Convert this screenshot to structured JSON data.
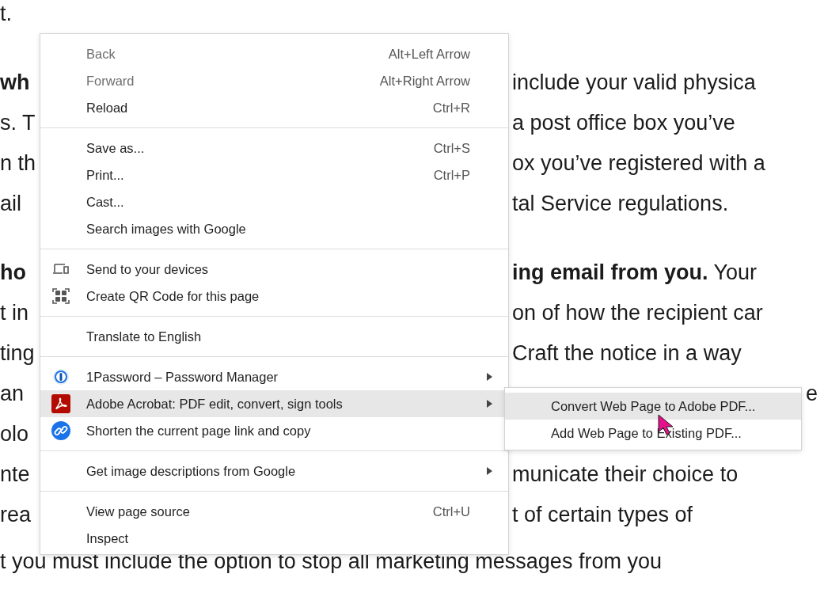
{
  "page_text": {
    "paragraphs": [
      [
        {
          "left": "t."
        }
      ],
      [
        {
          "left": "**wh**",
          "right": "include your valid physica"
        },
        {
          "left": "s. T",
          "right": "a post office box you’ve"
        },
        {
          "left": "n th",
          "right": "ox you’ve registered with a"
        },
        {
          "left": "ail",
          "right": "tal Service regulations."
        }
      ],
      [
        {
          "left": "**ho**",
          "right": "**ing email from you.** Your"
        },
        {
          "left": "t in",
          "right": "on of how the recipient car"
        },
        {
          "left": "ting",
          "right": "Craft the notice in a way"
        },
        {
          "left": "an",
          "end": "e"
        },
        {
          "left": "olo"
        },
        {
          "left": "nte",
          "right": "municate their choice to"
        },
        {
          "left": "rea",
          "right": "t of certain types of"
        },
        {
          "full": "t you must include the option to stop all marketing messages from you"
        }
      ]
    ]
  },
  "context_menu": {
    "groups": [
      [
        {
          "label": "Back",
          "shortcut": "Alt+Left Arrow",
          "disabled": true,
          "selected": false,
          "submenu": false
        },
        {
          "label": "Forward",
          "shortcut": "Alt+Right Arrow",
          "disabled": true,
          "selected": false,
          "submenu": false
        },
        {
          "label": "Reload",
          "shortcut": "Ctrl+R",
          "disabled": false,
          "selected": false,
          "submenu": false
        }
      ],
      [
        {
          "label": "Save as...",
          "shortcut": "Ctrl+S",
          "disabled": false,
          "selected": false,
          "submenu": false
        },
        {
          "label": "Print...",
          "shortcut": "Ctrl+P",
          "disabled": false,
          "selected": false,
          "submenu": false
        },
        {
          "label": "Cast...",
          "disabled": false,
          "selected": false,
          "submenu": false
        },
        {
          "label": "Search images with Google",
          "disabled": false,
          "selected": false,
          "submenu": false
        }
      ],
      [
        {
          "label": "Send to your devices",
          "kind": "devices",
          "disabled": false,
          "selected": false,
          "submenu": false
        },
        {
          "label": "Create QR Code for this page",
          "kind": "qr",
          "disabled": false,
          "selected": false,
          "submenu": false
        }
      ],
      [
        {
          "label": "Translate to English",
          "disabled": false,
          "selected": false,
          "submenu": false
        }
      ],
      [
        {
          "label": "1Password – Password Manager",
          "kind": "keyhole",
          "disabled": false,
          "selected": false,
          "submenu": true
        },
        {
          "label": "Adobe Acrobat: PDF edit, convert, sign tools",
          "kind": "acrobat",
          "disabled": false,
          "selected": true,
          "submenu": true
        },
        {
          "label": "Shorten the current page link and copy",
          "kind": "link",
          "disabled": false,
          "selected": false,
          "submenu": false
        }
      ],
      [
        {
          "label": "Get image descriptions from Google",
          "disabled": false,
          "selected": false,
          "submenu": true
        }
      ],
      [
        {
          "label": "View page source",
          "shortcut": "Ctrl+U",
          "disabled": false,
          "selected": false,
          "submenu": false
        },
        {
          "label": "Inspect",
          "disabled": false,
          "selected": false,
          "submenu": false
        }
      ]
    ]
  },
  "submenu": {
    "items": [
      {
        "label": "Convert Web Page to Adobe PDF...",
        "selected": true
      },
      {
        "label": "Add Web Page to Existing PDF...",
        "selected": false
      }
    ]
  }
}
